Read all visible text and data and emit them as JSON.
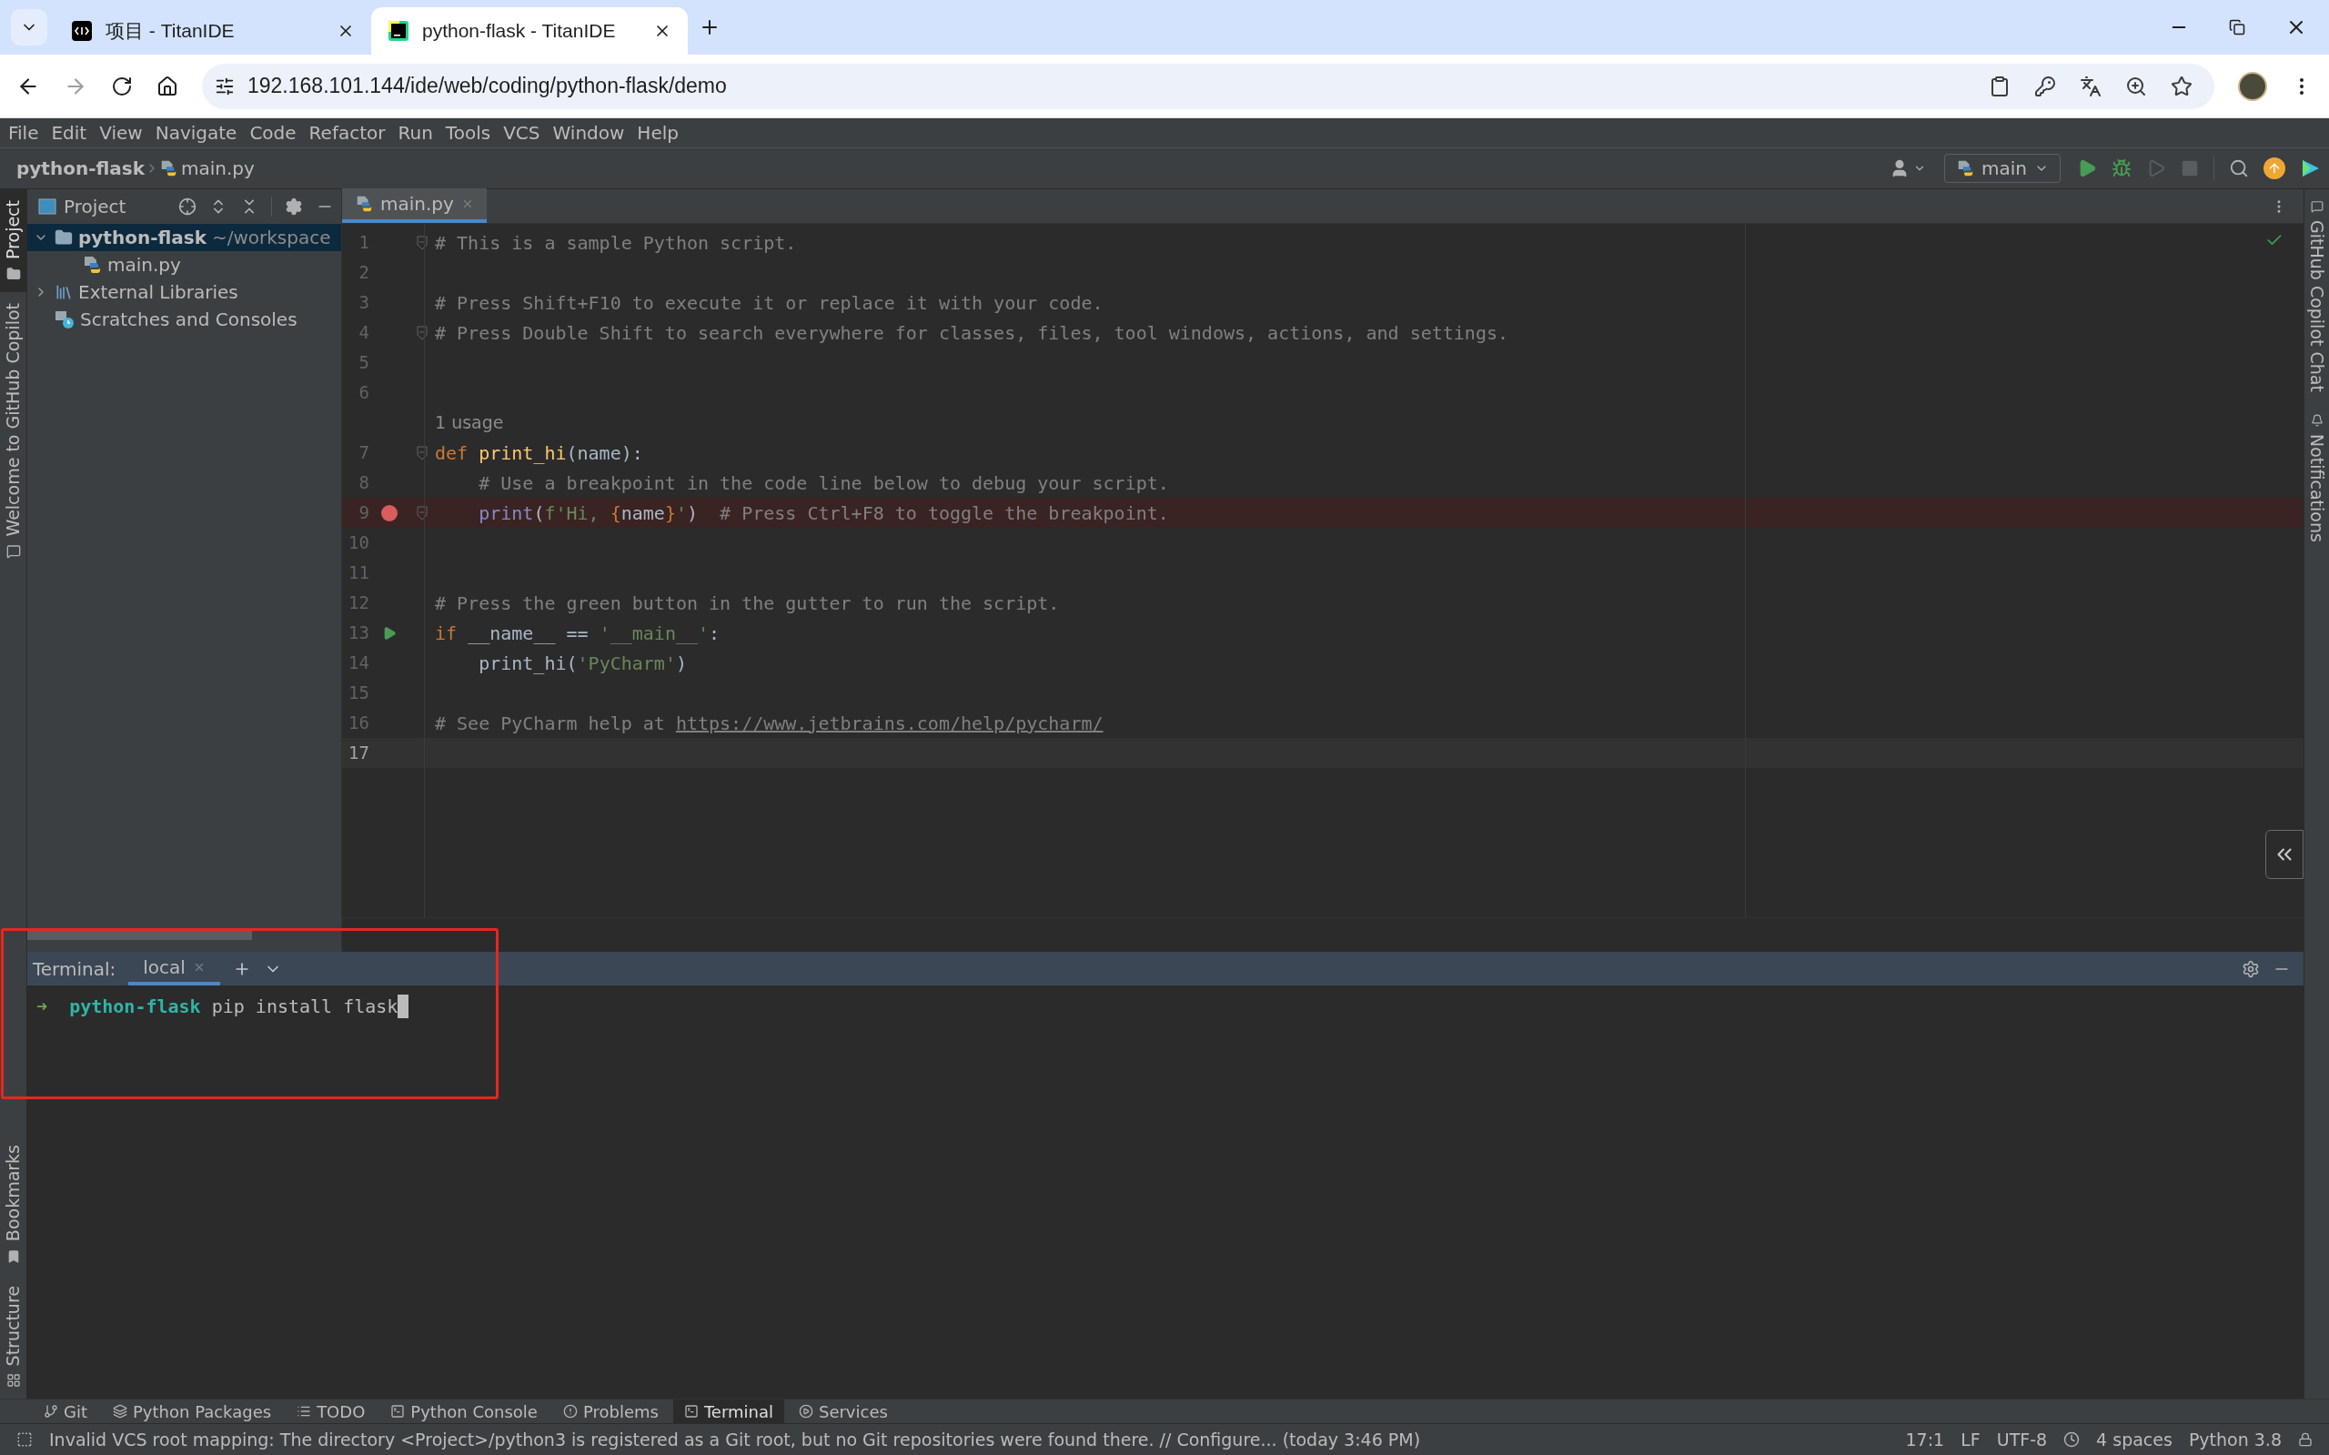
{
  "browser": {
    "tabs": [
      {
        "title": "项目 - TitanIDE",
        "selected": false
      },
      {
        "title": "python-flask - TitanIDE",
        "selected": true
      }
    ],
    "address": "192.168.101.144/ide/web/coding/python-flask/demo"
  },
  "menu": [
    "File",
    "Edit",
    "View",
    "Navigate",
    "Code",
    "Refactor",
    "Run",
    "Tools",
    "VCS",
    "Window",
    "Help"
  ],
  "breadcrumb": {
    "project": "python-flask",
    "file": "main.py"
  },
  "run_config": "main",
  "left_stripe": [
    {
      "label": "Project",
      "selected": true
    },
    {
      "label": "Welcome to GitHub Copilot",
      "selected": false
    }
  ],
  "left_stripe_bottom": [
    {
      "label": "Bookmarks"
    },
    {
      "label": "Structure"
    }
  ],
  "right_stripe": [
    {
      "label": "GitHub Copilot Chat"
    },
    {
      "label": "Notifications"
    }
  ],
  "project_panel": {
    "title": "Project",
    "tree": [
      {
        "name": "python-flask",
        "hint": "~/workspace",
        "kind": "folder",
        "expanded": true,
        "selected": true,
        "children": [
          {
            "name": "main.py",
            "kind": "python",
            "selected": false
          }
        ]
      },
      {
        "name": "External Libraries",
        "kind": "libraries",
        "expanded": false,
        "selected": false
      },
      {
        "name": "Scratches and Consoles",
        "kind": "scratches",
        "selected": false
      }
    ]
  },
  "editor": {
    "tabs": [
      {
        "title": "main.py",
        "selected": true
      }
    ],
    "lines": [
      {
        "kind": "code",
        "number": "1",
        "fold": true,
        "breakpoint": false,
        "run": false,
        "current": false,
        "tokens": [
          {
            "kind": "comment",
            "text": "# This is a sample Python script."
          }
        ]
      },
      {
        "kind": "code",
        "number": "2",
        "fold": false,
        "breakpoint": false,
        "run": false,
        "current": false
      },
      {
        "kind": "code",
        "number": "3",
        "fold": false,
        "breakpoint": false,
        "run": false,
        "current": false,
        "tokens": [
          {
            "kind": "comment",
            "text": "# Press Shift+F10 to execute it or replace it with your code."
          }
        ]
      },
      {
        "kind": "code",
        "number": "4",
        "fold": true,
        "breakpoint": false,
        "run": false,
        "current": false,
        "tokens": [
          {
            "kind": "comment",
            "text": "# Press Double Shift to search everywhere for classes, files, tool windows, actions, and settings."
          }
        ]
      },
      {
        "kind": "code",
        "number": "5",
        "fold": false,
        "breakpoint": false,
        "run": false,
        "current": false
      },
      {
        "kind": "code",
        "number": "6",
        "fold": false,
        "breakpoint": false,
        "run": false,
        "current": false
      },
      {
        "kind": "inlay",
        "text": "1 usage"
      },
      {
        "kind": "code",
        "number": "7",
        "fold": true,
        "breakpoint": false,
        "run": false,
        "current": false,
        "tokens": [
          {
            "kind": "keyword",
            "text": "def "
          },
          {
            "kind": "function",
            "text": "print_hi"
          },
          {
            "kind": "plain",
            "text": "(name):"
          }
        ]
      },
      {
        "kind": "code",
        "number": "8",
        "fold": false,
        "breakpoint": false,
        "run": false,
        "current": false,
        "tokens": [
          {
            "kind": "comment",
            "text": "    # Use a breakpoint in the code line below to debug your script."
          }
        ]
      },
      {
        "kind": "code",
        "number": "9",
        "fold": true,
        "breakpoint": true,
        "run": false,
        "current": false,
        "tokens": [
          {
            "kind": "builtin",
            "text": "    print"
          },
          {
            "kind": "plain",
            "text": "("
          },
          {
            "kind": "string",
            "text": "f'Hi, "
          },
          {
            "kind": "keyword",
            "text": "{"
          },
          {
            "kind": "plain",
            "text": "name"
          },
          {
            "kind": "keyword",
            "text": "}"
          },
          {
            "kind": "string",
            "text": "'"
          },
          {
            "kind": "plain",
            "text": ")  "
          },
          {
            "kind": "comment",
            "text": "# Press Ctrl+F8 to toggle the breakpoint."
          }
        ]
      },
      {
        "kind": "code",
        "number": "10",
        "fold": false,
        "breakpoint": false,
        "run": false,
        "current": false
      },
      {
        "kind": "code",
        "number": "11",
        "fold": false,
        "breakpoint": false,
        "run": false,
        "current": false
      },
      {
        "kind": "code",
        "number": "12",
        "fold": false,
        "breakpoint": false,
        "run": false,
        "current": false,
        "tokens": [
          {
            "kind": "comment",
            "text": "# Press the green button in the gutter to run the script."
          }
        ]
      },
      {
        "kind": "code",
        "number": "13",
        "fold": false,
        "breakpoint": false,
        "run": true,
        "current": false,
        "tokens": [
          {
            "kind": "keyword",
            "text": "if"
          },
          {
            "kind": "plain",
            "text": " __name__ == "
          },
          {
            "kind": "string",
            "text": "'__main__'"
          },
          {
            "kind": "plain",
            "text": ":"
          }
        ]
      },
      {
        "kind": "code",
        "number": "14",
        "fold": false,
        "breakpoint": false,
        "run": false,
        "current": false,
        "tokens": [
          {
            "kind": "plain",
            "text": "    print_hi("
          },
          {
            "kind": "string",
            "text": "'PyCharm'"
          },
          {
            "kind": "plain",
            "text": ")"
          }
        ]
      },
      {
        "kind": "code",
        "number": "15",
        "fold": false,
        "breakpoint": false,
        "run": false,
        "current": false
      },
      {
        "kind": "code",
        "number": "16",
        "fold": false,
        "breakpoint": false,
        "run": false,
        "current": false,
        "tokens": [
          {
            "kind": "comment",
            "text": "# See PyCharm help at "
          },
          {
            "kind": "link",
            "text": "https://www.jetbrains.com/help/pycharm/"
          }
        ]
      },
      {
        "kind": "code",
        "number": "17",
        "fold": false,
        "breakpoint": false,
        "run": false,
        "current": true
      }
    ]
  },
  "terminal": {
    "title": "Terminal:",
    "tabs": [
      {
        "title": "local",
        "selected": true
      }
    ],
    "prompt_symbol": "➜",
    "directory": "python-flask",
    "command": "pip install flask"
  },
  "tool_tabs": [
    {
      "label": "Git",
      "selected": false
    },
    {
      "label": "Python Packages",
      "selected": false
    },
    {
      "label": "TODO",
      "selected": false
    },
    {
      "label": "Python Console",
      "selected": false
    },
    {
      "label": "Problems",
      "selected": false
    },
    {
      "label": "Terminal",
      "selected": true
    },
    {
      "label": "Services",
      "selected": false
    }
  ],
  "status": {
    "message": "Invalid VCS root mapping: The directory <Project>/python3 is registered as a Git root, but no Git repositories were found there. // Configure... (today 3:46 PM)",
    "position": "17:1",
    "line_separator": "LF",
    "encoding": "UTF-8",
    "indent": "4 spaces",
    "interpreter": "Python 3.8"
  }
}
